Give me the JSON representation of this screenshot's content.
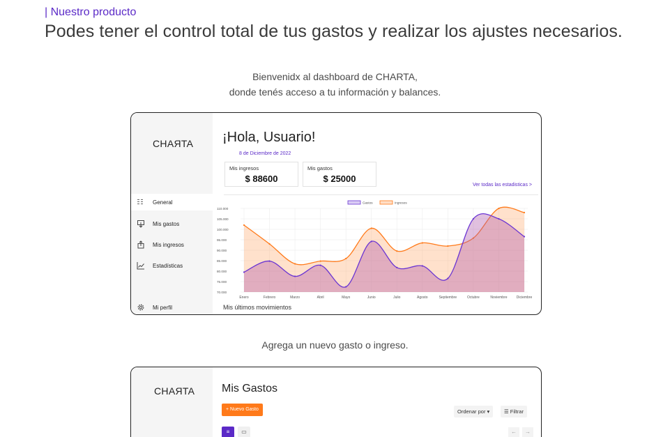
{
  "section": {
    "kicker": "| Nuestro producto",
    "headline": "Podes tener el control total de tus gastos y realizar los ajustes necesarios.",
    "intro_line1": "Bienvenidx al dashboard de CHARTA,",
    "intro_line2": "donde tenés acceso a tu información y balances.",
    "caption2": "Agrega un nuevo gasto o ingreso."
  },
  "dashboard": {
    "logo": "CHAЯTA",
    "nav": [
      {
        "label": "General",
        "icon": "grid-icon"
      },
      {
        "label": "Mis gastos",
        "icon": "download-icon"
      },
      {
        "label": "Mis ingresos",
        "icon": "upload-icon"
      },
      {
        "label": "Estadísticas",
        "icon": "trend-icon"
      },
      {
        "label": "Mi perfil",
        "icon": "gear-icon"
      }
    ],
    "greeting": "¡Hola, Usuario!",
    "date": "8 de Diciembre de 2022",
    "cards": [
      {
        "label": "Mis ingresos",
        "amount": "$ 88600"
      },
      {
        "label": "Mis gastos",
        "amount": "$ 25000"
      }
    ],
    "stats_link": "Ver todas las estadisticas >",
    "recent_title": "Mis últimos movimientos",
    "colors": {
      "purple": "#6a35d3",
      "orange": "#ff7a1a"
    }
  },
  "chart_data": {
    "type": "area",
    "categories": [
      "Enero",
      "Febrero",
      "Marzo",
      "Abril",
      "Mayo",
      "Junio",
      "Julio",
      "Agosto",
      "Septiembre",
      "Octubre",
      "Noviembre",
      "Diciembre"
    ],
    "y_tick_labels": [
      "110.000",
      "105.000",
      "100.000",
      "95.000",
      "90.000",
      "85.000",
      "80.000",
      "75.000",
      "70.000"
    ],
    "ylim": [
      70000,
      110000
    ],
    "legend": "top-center",
    "series": [
      {
        "name": "Gastos",
        "color": "#6a35d3",
        "values": [
          79500,
          84800,
          77500,
          82800,
          72500,
          94200,
          81700,
          82500,
          76500,
          105000,
          105000,
          96500
        ]
      },
      {
        "name": "Ingresos",
        "color": "#ff7a1a",
        "values": [
          102000,
          93000,
          83500,
          84800,
          86000,
          100500,
          89600,
          93500,
          92000,
          95800,
          110000,
          108000
        ]
      }
    ]
  },
  "expenses": {
    "logo": "CHAЯTA",
    "title": "Mis Gastos",
    "new_button": "+ Nuevo Gasto",
    "sort_label": "Ordenar por ▾",
    "filter_label": "☰ Filtrar",
    "list_icon": "≡",
    "grid_icon": "▭",
    "prev": "←",
    "next": "→"
  }
}
